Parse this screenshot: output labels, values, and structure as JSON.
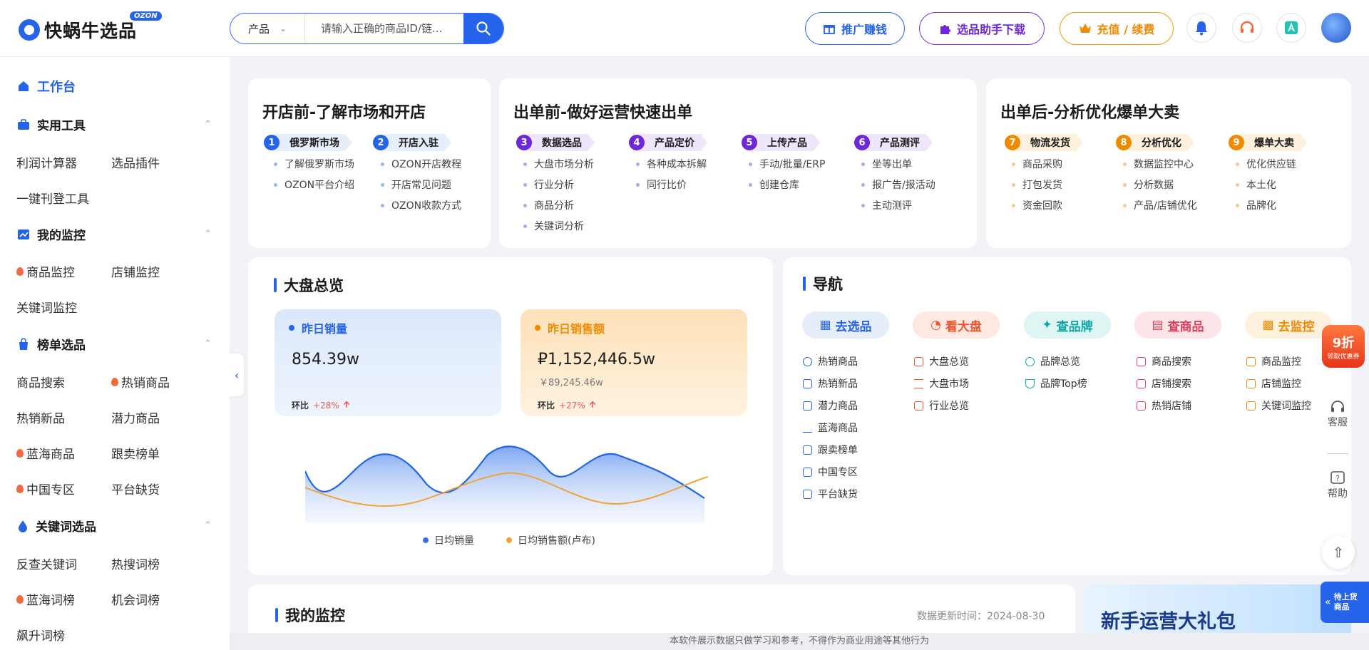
{
  "header": {
    "logo_text": "快蜗牛选品",
    "logo_badge": "OZON",
    "search_category": "产品",
    "search_placeholder": "请输入正确的商品ID/链...",
    "promo_label": "推广赚钱",
    "plugin_label": "选品助手下载",
    "recharge_label": "充值 / 续费"
  },
  "sidebar": {
    "workbench": "工作台",
    "groups": [
      {
        "title": "实用工具",
        "items": [
          "利润计算器",
          "选品插件",
          "一键刊登工具"
        ]
      },
      {
        "title": "我的监控",
        "items": [
          "商品监控",
          "店铺监控",
          "关键词监控"
        ]
      },
      {
        "title": "榜单选品",
        "items": [
          "商品搜索",
          "热销商品",
          "热销新品",
          "潜力商品",
          "蓝海商品",
          "跟卖榜单",
          "中国专区",
          "平台缺货"
        ]
      },
      {
        "title": "关键词选品",
        "items": [
          "反查关键词",
          "热搜词榜",
          "蓝海词榜",
          "机会词榜",
          "飙升词榜"
        ]
      }
    ]
  },
  "stages": [
    {
      "title": "开店前-了解市场和开店",
      "steps": [
        {
          "num": "1",
          "label": "俄罗斯市场",
          "items": [
            "了解俄罗斯市场",
            "OZON平台介绍"
          ]
        },
        {
          "num": "2",
          "label": "开店入驻",
          "items": [
            "OZON开店教程",
            "开店常见问题",
            "OZON收款方式"
          ]
        }
      ]
    },
    {
      "title": "出单前-做好运营快速出单",
      "steps": [
        {
          "num": "3",
          "label": "数据选品",
          "items": [
            "大盘市场分析",
            "行业分析",
            "商品分析",
            "关键词分析"
          ]
        },
        {
          "num": "4",
          "label": "产品定价",
          "items": [
            "各种成本拆解",
            "同行比价"
          ]
        },
        {
          "num": "5",
          "label": "上传产品",
          "items": [
            "手动/批量/ERP",
            "创建仓库"
          ]
        },
        {
          "num": "6",
          "label": "产品测评",
          "items": [
            "坐等出单",
            "报广告/报活动",
            "主动测评"
          ]
        }
      ]
    },
    {
      "title": "出单后-分析优化爆单大卖",
      "steps": [
        {
          "num": "7",
          "label": "物流发货",
          "items": [
            "商品采购",
            "打包发货",
            "资金回款"
          ]
        },
        {
          "num": "8",
          "label": "分析优化",
          "items": [
            "数据监控中心",
            "分析数据",
            "产品/店铺优化"
          ]
        },
        {
          "num": "9",
          "label": "爆单大卖",
          "items": [
            "优化供应链",
            "本土化",
            "品牌化"
          ]
        }
      ]
    }
  ],
  "overview": {
    "title": "大盘总览",
    "sales": {
      "label": "昨日销量",
      "value": "854.39w",
      "ratio_label": "环比",
      "ratio": "+28%"
    },
    "revenue": {
      "label": "昨日销售额",
      "value": "₽1,152,446.5w",
      "sub": "￥89,245.46w",
      "ratio_label": "环比",
      "ratio": "+27%"
    },
    "legend": [
      "日均销量",
      "日均销售额(卢布)"
    ]
  },
  "nav": {
    "title": "导航",
    "columns": [
      {
        "pill": "去选品",
        "color": "#2563eb",
        "bg": "#e6eefc",
        "links": [
          "热销商品",
          "热销新品",
          "潜力商品",
          "蓝海商品",
          "跟卖榜单",
          "中国专区",
          "平台缺货"
        ]
      },
      {
        "pill": "看大盘",
        "color": "#f0542d",
        "bg": "#fde9e2",
        "links": [
          "大盘总览",
          "大盘市场",
          "行业总览"
        ]
      },
      {
        "pill": "查品牌",
        "color": "#10a5a5",
        "bg": "#def5f4",
        "links": [
          "品牌总览",
          "品牌Top榜"
        ]
      },
      {
        "pill": "查商品",
        "color": "#e0405a",
        "bg": "#fde6ea",
        "links": [
          "商品搜索",
          "店铺搜索",
          "热销店铺"
        ]
      },
      {
        "pill": "去监控",
        "color": "#f08a00",
        "bg": "#fdf0dc",
        "links": [
          "商品监控",
          "店铺监控",
          "关键词监控"
        ]
      }
    ]
  },
  "monitor": {
    "title": "我的监控",
    "update_label": "数据更新时间：2024-08-30"
  },
  "banner": {
    "text": "新手运营大礼包"
  },
  "floating": {
    "discount": "9折",
    "discount_sub": "领取优惠券",
    "service": "客服",
    "help": "帮助",
    "pending": "待上货商品"
  },
  "footer": "本软件展示数据只做学习和参考，不得作为商业用途等其他行为"
}
